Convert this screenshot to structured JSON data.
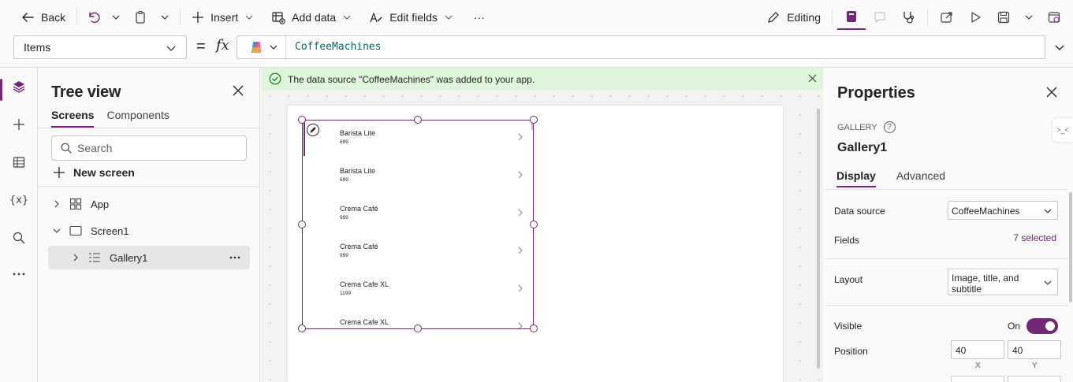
{
  "toolbar": {
    "back": "Back",
    "insert": "Insert",
    "add_data": "Add data",
    "edit_fields": "Edit fields",
    "more": "···",
    "editing": "Editing"
  },
  "formula": {
    "property": "Items",
    "equals": "=",
    "fx": "fx",
    "value": "CoffeeMachines"
  },
  "tree": {
    "title": "Tree view",
    "tabs": [
      "Screens",
      "Components"
    ],
    "search_placeholder": "Search",
    "new_screen": "New screen",
    "nodes": [
      {
        "label": "App"
      },
      {
        "label": "Screen1"
      },
      {
        "label": "Gallery1"
      }
    ]
  },
  "canvas": {
    "banner": "The data source \"CoffeeMachines\" was added to your app.",
    "gallery_items": [
      {
        "title": "Barista Lite",
        "subtitle": "699"
      },
      {
        "title": "Barista Lite",
        "subtitle": "699"
      },
      {
        "title": "Crema Café",
        "subtitle": "999"
      },
      {
        "title": "Crema Café",
        "subtitle": "999"
      },
      {
        "title": "Crema Cafe XL",
        "subtitle": "1199"
      },
      {
        "title": "Crema Cafe XL",
        "subtitle": ""
      }
    ]
  },
  "properties": {
    "title": "Properties",
    "control_type": "GALLERY",
    "help": "?",
    "control_name": "Gallery1",
    "tabs": [
      "Display",
      "Advanced"
    ],
    "data_source_label": "Data source",
    "data_source_value": "CoffeeMachines",
    "fields_label": "Fields",
    "fields_value": "7 selected",
    "layout_label": "Layout",
    "layout_value": "Image, title, and subtitle",
    "visible_label": "Visible",
    "visible_value": "On",
    "position_label": "Position",
    "position_x": "40",
    "position_y": "40",
    "x_label": "X",
    "y_label": "Y",
    "side_badge": ">_<"
  },
  "colors": {
    "accent": "#742774",
    "banner_bg": "#dff6dd",
    "success": "#107c10",
    "formula_text": "#0b6a6b"
  }
}
